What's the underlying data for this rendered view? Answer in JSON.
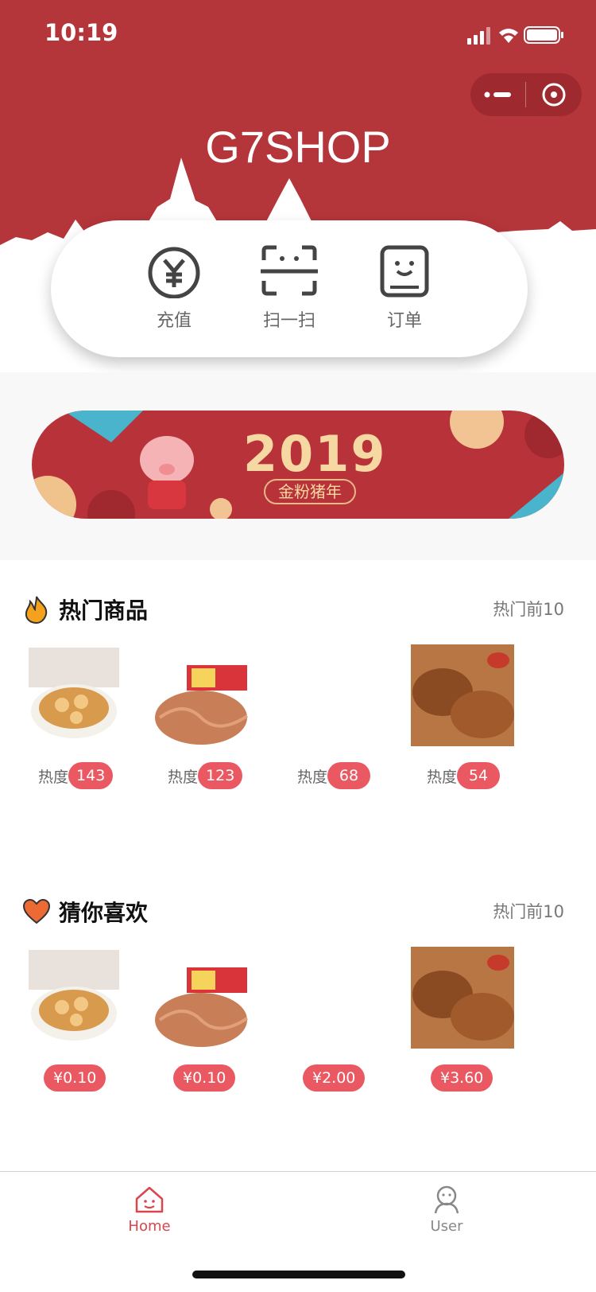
{
  "status_bar": {
    "time": "10:19"
  },
  "capsule": {
    "more_icon": "more-dots-icon",
    "close_icon": "close-circle-icon"
  },
  "header": {
    "title": "G7SHOP",
    "bg_color": "#b4353a"
  },
  "quick_actions": [
    {
      "label": "充值",
      "icon": "yuan-icon"
    },
    {
      "label": "扫一扫",
      "icon": "scan-icon"
    },
    {
      "label": "订单",
      "icon": "order-icon"
    }
  ],
  "banner": {
    "year": "2019",
    "tagline": "金粉猪年"
  },
  "hot_section": {
    "title": "热门商品",
    "right_text": "热门前10",
    "icon": "flame-icon",
    "heat_label": "热度",
    "items": [
      {
        "heat": "143",
        "thumb": "lotus-root-snack"
      },
      {
        "heat": "123",
        "thumb": "shredded-snack-pack"
      },
      {
        "heat": "68",
        "thumb": ""
      },
      {
        "heat": "54",
        "thumb": "braised-meat"
      }
    ]
  },
  "like_section": {
    "title": "猜你喜欢",
    "right_text": "热门前10",
    "icon": "heart-icon",
    "items": [
      {
        "price": "¥0.10",
        "thumb": "lotus-root-snack"
      },
      {
        "price": "¥0.10",
        "thumb": "shredded-snack-pack"
      },
      {
        "price": "¥2.00",
        "thumb": ""
      },
      {
        "price": "¥3.60",
        "thumb": "braised-meat"
      }
    ]
  },
  "tab_bar": {
    "tabs": [
      {
        "label": "Home",
        "icon": "home-icon",
        "active": true
      },
      {
        "label": "User",
        "icon": "user-icon",
        "active": false
      }
    ],
    "active_color": "#d9464e",
    "inactive_color": "#888888"
  }
}
